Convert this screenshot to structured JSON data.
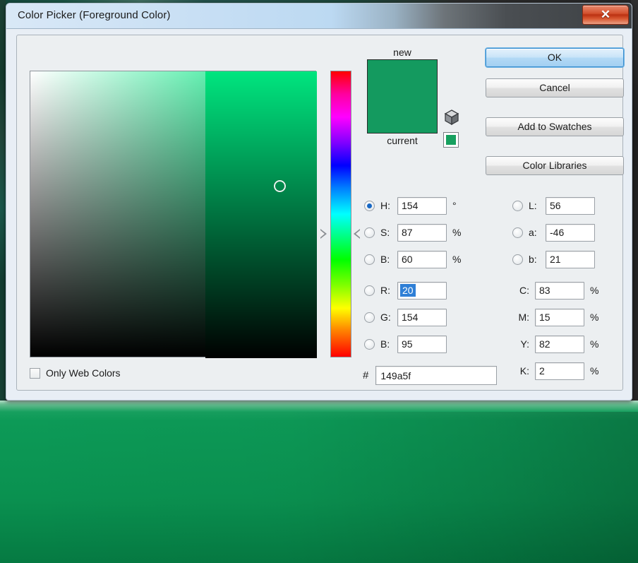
{
  "window": {
    "title": "Color Picker (Foreground Color)",
    "close_label": "✕"
  },
  "swatches": {
    "new_label": "new",
    "current_label": "current",
    "new_color": "#149a5f",
    "current_color": "#149a5f",
    "websafe_chip_color": "#17a05f",
    "gamut_icon": "cube-icon",
    "websafe_icon": "websafe-swatch-icon"
  },
  "buttons": {
    "ok": "OK",
    "cancel": "Cancel",
    "add_to_swatches": "Add to Swatches",
    "color_libraries": "Color Libraries"
  },
  "fields": {
    "hsb": [
      {
        "name": "hue",
        "label": "H:",
        "value": "154",
        "unit": "°",
        "selected_radio": true,
        "radio": true
      },
      {
        "name": "saturation",
        "label": "S:",
        "value": "87",
        "unit": "%",
        "selected_radio": false,
        "radio": true
      },
      {
        "name": "brightness",
        "label": "B:",
        "value": "60",
        "unit": "%",
        "selected_radio": false,
        "radio": true
      }
    ],
    "rgb": [
      {
        "name": "red",
        "label": "R:",
        "value": "20",
        "unit": "",
        "selected_radio": false,
        "radio": true,
        "text_selected": true
      },
      {
        "name": "green",
        "label": "G:",
        "value": "154",
        "unit": "",
        "selected_radio": false,
        "radio": true
      },
      {
        "name": "blue",
        "label": "B:",
        "value": "95",
        "unit": "",
        "selected_radio": false,
        "radio": true
      }
    ],
    "lab": [
      {
        "name": "lightness",
        "label": "L:",
        "value": "56",
        "unit": "",
        "selected_radio": false,
        "radio": true
      },
      {
        "name": "a-axis",
        "label": "a:",
        "value": "-46",
        "unit": "",
        "selected_radio": false,
        "radio": true
      },
      {
        "name": "b-axis",
        "label": "b:",
        "value": "21",
        "unit": "",
        "selected_radio": false,
        "radio": true
      }
    ],
    "cmyk": [
      {
        "name": "cyan",
        "label": "C:",
        "value": "83",
        "unit": "%",
        "radio": false
      },
      {
        "name": "magenta",
        "label": "M:",
        "value": "15",
        "unit": "%",
        "radio": false
      },
      {
        "name": "yellow",
        "label": "Y:",
        "value": "82",
        "unit": "%",
        "radio": false
      },
      {
        "name": "black",
        "label": "K:",
        "value": "2",
        "unit": "%",
        "radio": false
      }
    ]
  },
  "only_web_colors": {
    "label": "Only Web Colors",
    "checked": false
  },
  "hex": {
    "hash": "#",
    "value": "149a5f"
  },
  "picker": {
    "hue_degrees": 154,
    "marker_x_pct": 87,
    "marker_y_pct": 40,
    "hue_marker_pct": 57
  },
  "colors": {
    "accent_blue": "#2f7fd6",
    "selected_color": "#149a5f",
    "hue_color": "#00e57f",
    "canvas_green": "#0a9150"
  }
}
